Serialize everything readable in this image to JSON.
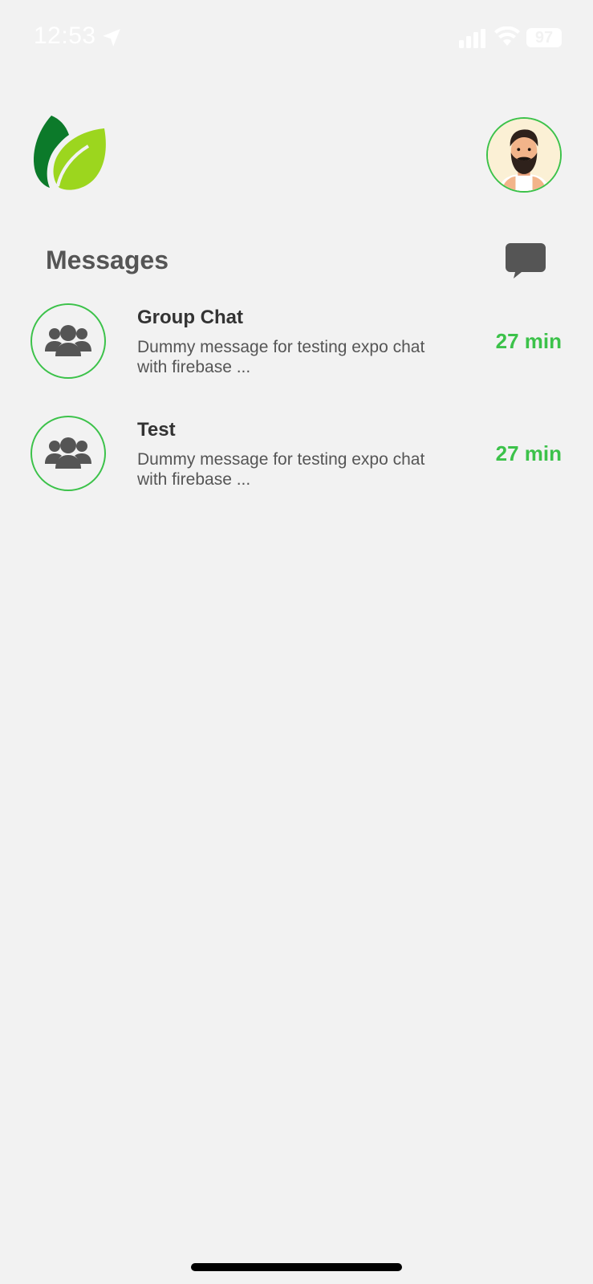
{
  "status_bar": {
    "time": "12:53",
    "battery": "97",
    "icons": [
      "location-arrow-icon",
      "signal-icon",
      "wifi-icon",
      "battery-icon"
    ]
  },
  "header": {
    "logo_icon": "leaf-logo-icon",
    "profile_icon": "bearded-man-avatar"
  },
  "messages": {
    "title": "Messages",
    "compose_icon": "chat-bubble-icon",
    "chats": [
      {
        "name": "Group Chat",
        "preview": "Dummy message for testing expo chat with firebase ...",
        "time": "27 min",
        "icon": "users-group-icon"
      },
      {
        "name": "Test",
        "preview": "Dummy message for testing expo chat with firebase ...",
        "time": "27 min",
        "icon": "users-group-icon"
      }
    ]
  },
  "colors": {
    "background": "#f2f2f2",
    "accent_green": "#3cc24a",
    "text_dark": "#333333",
    "text_muted": "#555555",
    "logo_dark_green": "#0c7a2a",
    "logo_light_green": "#9cd61e"
  }
}
